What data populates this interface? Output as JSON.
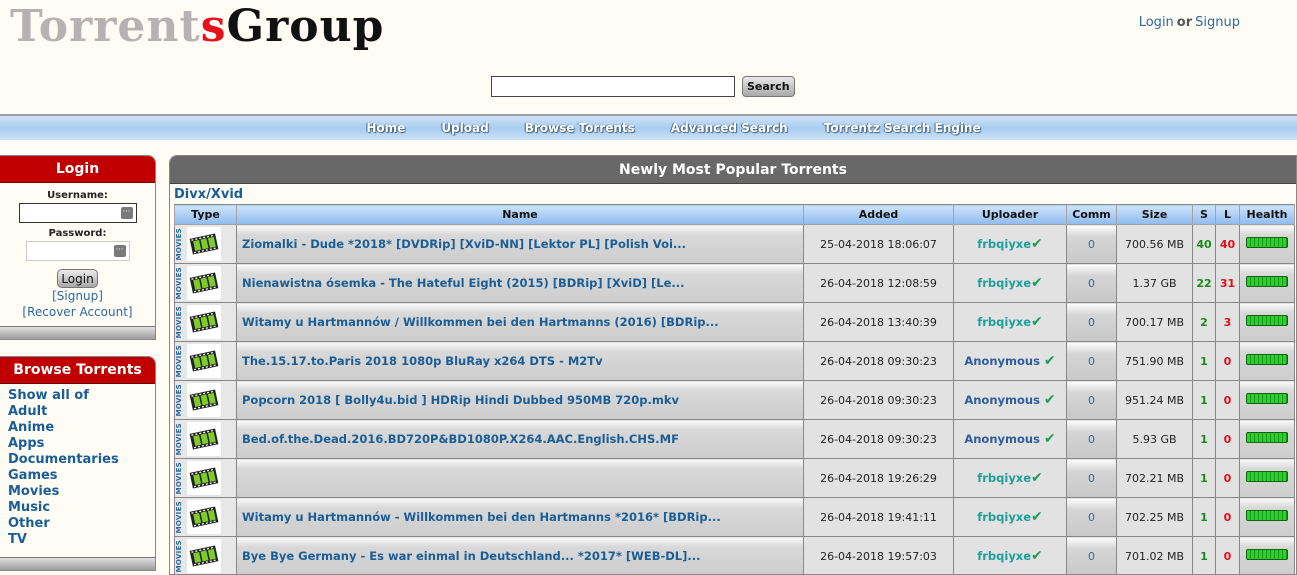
{
  "header": {
    "logo": {
      "part1": "Torrent",
      "part2": "s",
      "part3": "Group"
    },
    "auth": {
      "login": "Login",
      "or": "or",
      "signup": "Signup"
    },
    "search": {
      "value": "",
      "placeholder": "",
      "button": "Search"
    }
  },
  "nav": [
    "Home",
    "Upload",
    "Browse Torrents",
    "Advanced Search",
    "Torrentz Search Engine"
  ],
  "login_box": {
    "title": "Login",
    "username_label": "Username:",
    "password_label": "Password:",
    "username_value": "",
    "password_value": "",
    "button": "Login",
    "signup_link": "[Signup]",
    "recover_link": "[Recover Account]"
  },
  "browse_box": {
    "title": "Browse Torrents",
    "items": [
      "Show all of",
      "Adult",
      "Anime",
      "Apps",
      "Documentaries",
      "Games",
      "Movies",
      "Music",
      "Other",
      "TV"
    ]
  },
  "main": {
    "title": "Newly Most Popular Torrents",
    "category": "Divx/Xvid",
    "columns": [
      "Type",
      "Name",
      "Added",
      "Uploader",
      "Comm",
      "Size",
      "S",
      "L",
      "Health"
    ],
    "rows": [
      {
        "type": "MOVIES",
        "name": "Ziomalki - Dude *2018* [DVDRip] [XviD-NN] [Lektor PL] [Polish Voi...",
        "added": "25-04-2018 18:06:07",
        "uploader": "frbqiyxe",
        "uploader_kind": "user",
        "comm": "0",
        "size": "700.56 MB",
        "seeders": "40",
        "leechers": "40",
        "health": 1.0
      },
      {
        "type": "MOVIES",
        "name": "Nienawistna ósemka - The Hateful Eight (2015) [BDRip] [XviD] [Le...",
        "added": "26-04-2018 12:08:59",
        "uploader": "frbqiyxe",
        "uploader_kind": "user",
        "comm": "0",
        "size": "1.37 GB",
        "seeders": "22",
        "leechers": "31",
        "health": 1.0
      },
      {
        "type": "MOVIES",
        "name": "Witamy u Hartmannów / Willkommen bei den Hartmanns (2016) [BDRip...",
        "added": "26-04-2018 13:40:39",
        "uploader": "frbqiyxe",
        "uploader_kind": "user",
        "comm": "0",
        "size": "700.17 MB",
        "seeders": "2",
        "leechers": "3",
        "health": 1.0
      },
      {
        "type": "MOVIES",
        "name": "The.15.17.to.Paris 2018 1080p BluRay x264 DTS - M2Tv",
        "added": "26-04-2018 09:30:23",
        "uploader": "Anonymous",
        "uploader_kind": "anon",
        "comm": "0",
        "size": "751.90 MB",
        "seeders": "1",
        "leechers": "0",
        "health": 1.0
      },
      {
        "type": "MOVIES",
        "name": "Popcorn 2018 [ Bolly4u.bid ] HDRip Hindi Dubbed 950MB 720p.mkv",
        "added": "26-04-2018 09:30:23",
        "uploader": "Anonymous",
        "uploader_kind": "anon",
        "comm": "0",
        "size": "951.24 MB",
        "seeders": "1",
        "leechers": "0",
        "health": 1.0
      },
      {
        "type": "MOVIES",
        "name": "Bed.of.the.Dead.2016.BD720P&BD1080P.X264.AAC.English.CHS.MF",
        "added": "26-04-2018 09:30:23",
        "uploader": "Anonymous",
        "uploader_kind": "anon",
        "comm": "0",
        "size": "5.93 GB",
        "seeders": "1",
        "leechers": "0",
        "health": 1.0
      },
      {
        "type": "MOVIES",
        "name": "",
        "added": "26-04-2018 19:26:29",
        "uploader": "frbqiyxe",
        "uploader_kind": "user",
        "comm": "0",
        "size": "702.21 MB",
        "seeders": "1",
        "leechers": "0",
        "health": 1.0
      },
      {
        "type": "MOVIES",
        "name": "Witamy u Hartmannów - Willkommen bei den Hartmanns *2016* [BDRip...",
        "added": "26-04-2018 19:41:11",
        "uploader": "frbqiyxe",
        "uploader_kind": "user",
        "comm": "0",
        "size": "702.25 MB",
        "seeders": "1",
        "leechers": "0",
        "health": 1.0
      },
      {
        "type": "MOVIES",
        "name": "Bye Bye Germany - Es war einmal in Deutschland... *2017* [WEB-DL]...",
        "added": "26-04-2018 19:57:03",
        "uploader": "frbqiyxe",
        "uploader_kind": "user",
        "comm": "0",
        "size": "701.02 MB",
        "seeders": "1",
        "leechers": "0",
        "health": 1.0
      }
    ]
  },
  "icons": {
    "type": "film-reel-icon",
    "verified": "checkmark-icon",
    "health": "health-bar-icon"
  },
  "colors": {
    "accent_red": "#c00000",
    "link_blue": "#1b5e96",
    "seed_green": "#1a8a1a",
    "leech_red": "#e0101a",
    "nav_blue": "#a9cdf1"
  }
}
